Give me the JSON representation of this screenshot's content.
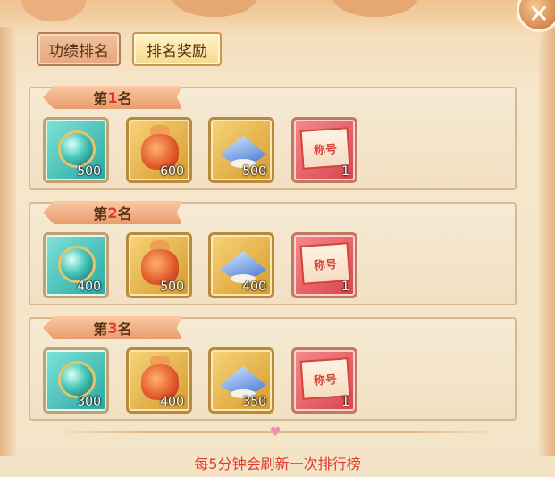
{
  "tabs": [
    {
      "label": "功绩排名",
      "active": false
    },
    {
      "label": "排名奖励",
      "active": true
    }
  ],
  "close_icon": "close-icon",
  "ranks": [
    {
      "prefix": "第",
      "num": "1",
      "suffix": "名",
      "rewards": [
        {
          "icon": "jade-orb-icon",
          "count": "500"
        },
        {
          "icon": "lucky-bag-icon",
          "count": "600"
        },
        {
          "icon": "blue-hat-icon",
          "count": "500"
        },
        {
          "icon": "title-card-icon",
          "count": "1",
          "card_text": "称号"
        }
      ]
    },
    {
      "prefix": "第",
      "num": "2",
      "suffix": "名",
      "rewards": [
        {
          "icon": "jade-orb-icon",
          "count": "400"
        },
        {
          "icon": "lucky-bag-icon",
          "count": "500"
        },
        {
          "icon": "blue-hat-icon",
          "count": "400"
        },
        {
          "icon": "title-card-icon",
          "count": "1",
          "card_text": "称号"
        }
      ]
    },
    {
      "prefix": "第",
      "num": "3",
      "suffix": "名",
      "rewards": [
        {
          "icon": "jade-orb-icon",
          "count": "300"
        },
        {
          "icon": "lucky-bag-icon",
          "count": "400"
        },
        {
          "icon": "blue-hat-icon",
          "count": "350"
        },
        {
          "icon": "title-card-icon",
          "count": "1",
          "card_text": "称号"
        }
      ]
    }
  ],
  "footer_text": "每5分钟会刷新一次排行榜",
  "colors": {
    "accent_red": "#e03a2a",
    "banner": "#e99b6e",
    "panel_bg": "#f6ead4"
  }
}
